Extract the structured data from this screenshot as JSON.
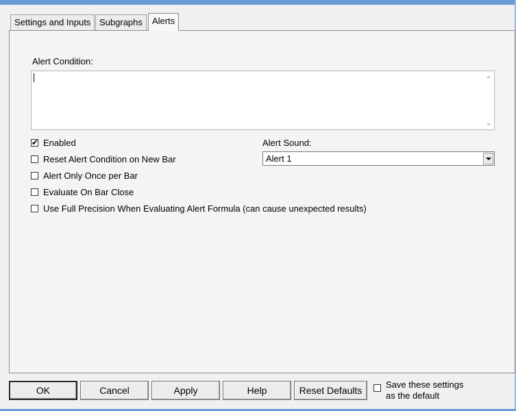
{
  "tabs": [
    {
      "label": "Settings and Inputs"
    },
    {
      "label": "Subgraphs"
    },
    {
      "label": "Alerts"
    }
  ],
  "alerts": {
    "condition_label": "Alert Condition:",
    "condition_value": "",
    "options": [
      {
        "label": "Enabled",
        "checked": true
      },
      {
        "label": "Reset Alert Condition on New Bar",
        "checked": false
      },
      {
        "label": "Alert Only Once per Bar",
        "checked": false
      },
      {
        "label": "Evaluate On Bar Close",
        "checked": false
      },
      {
        "label": "Use Full Precision When Evaluating Alert Formula (can cause unexpected results)",
        "checked": false
      }
    ],
    "sound_label": "Alert Sound:",
    "sound_value": "Alert 1"
  },
  "buttons": {
    "ok": "OK",
    "cancel": "Cancel",
    "apply": "Apply",
    "help": "Help",
    "reset_defaults": "Reset Defaults"
  },
  "save_default": {
    "label_line1": "Save these settings",
    "label_line2": "as the default",
    "checked": false
  },
  "check_glyph": "✔",
  "colors": {
    "title_bar": "#6b9ad9",
    "panel_bg": "#f4f4f4"
  }
}
